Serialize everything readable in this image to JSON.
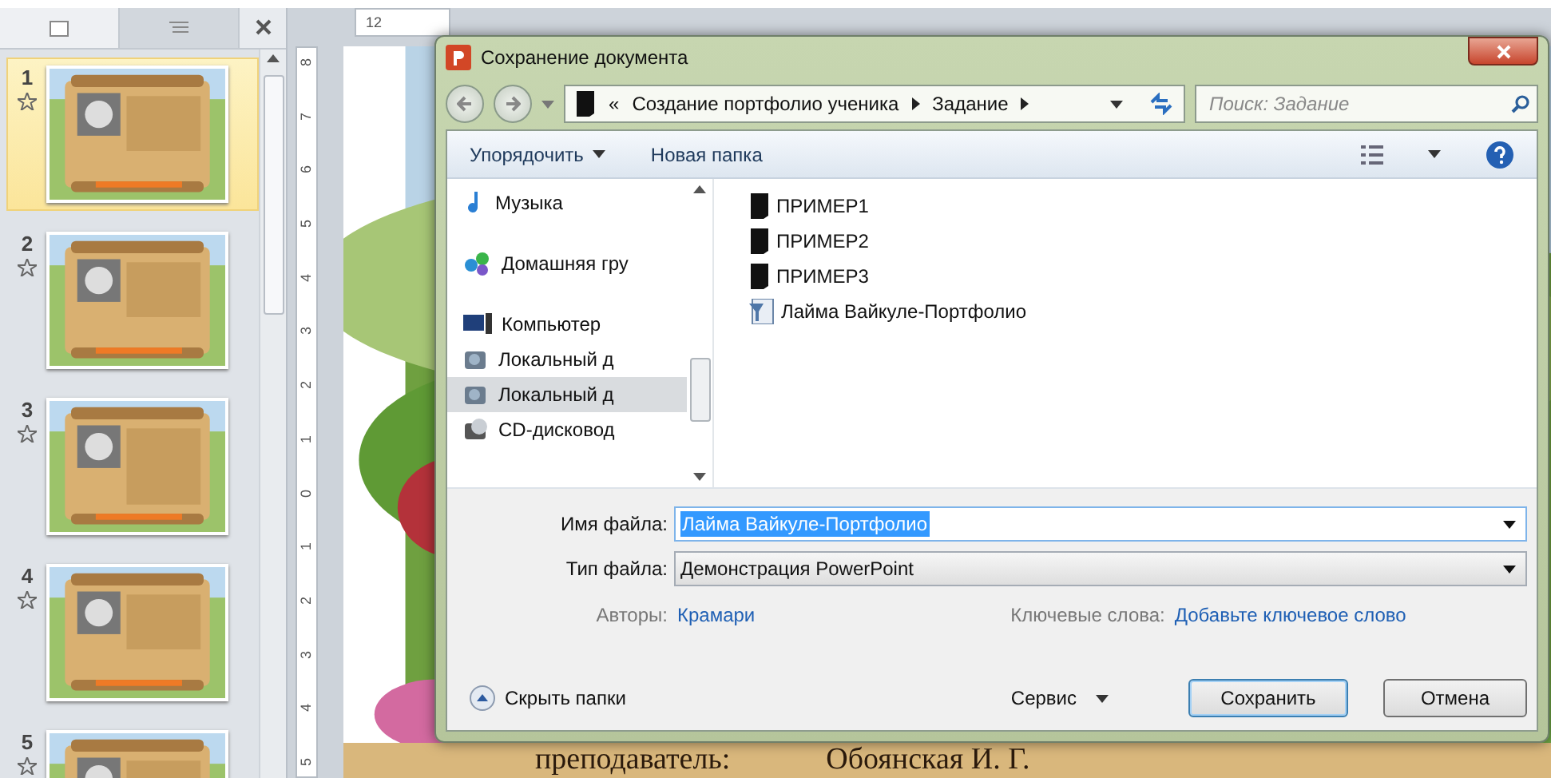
{
  "slides_panel": {
    "tabs": [
      {
        "kind": "slides",
        "selected": true
      },
      {
        "kind": "outline",
        "selected": false
      }
    ],
    "slides": [
      {
        "number": "1",
        "selected": true
      },
      {
        "number": "2",
        "selected": false
      },
      {
        "number": "3",
        "selected": false
      },
      {
        "number": "4",
        "selected": false
      },
      {
        "number": "5",
        "selected": false
      }
    ]
  },
  "horizontal_ruler": [
    "12"
  ],
  "vertical_ruler": [
    "8",
    "7",
    "6",
    "5",
    "4",
    "3",
    "2",
    "1",
    "0",
    "1",
    "2",
    "3",
    "4",
    "5"
  ],
  "slide_text": [
    "преподаватель:",
    "Обоянская И. Г."
  ],
  "dialog": {
    "title": "Сохранение документа",
    "breadcrumb": [
      "«",
      "Создание портфолио ученика",
      "Задание"
    ],
    "search": {
      "placeholder": "Поиск: Задание"
    },
    "toolbar": [
      "Упорядочить",
      "Новая папка"
    ],
    "nav": [
      {
        "kind": "music",
        "label": "Музыка",
        "selected": false
      },
      {
        "kind": "homegroup",
        "label": "Домашняя гру",
        "selected": false
      },
      {
        "kind": "computer",
        "label": "Компьютер",
        "selected": false
      },
      {
        "kind": "disk",
        "label": "Локальный д",
        "selected": false
      },
      {
        "kind": "disk",
        "label": "Локальный д",
        "selected": true
      },
      {
        "kind": "cd",
        "label": "CD-дисковод",
        "selected": false
      }
    ],
    "files": [
      {
        "kind": "folder",
        "name": "ПРИМЕР1"
      },
      {
        "kind": "folder",
        "name": "ПРИМЕР2"
      },
      {
        "kind": "folder",
        "name": "ПРИМЕР3"
      },
      {
        "kind": "presentation",
        "name": "Лайма Вайкуле-Портфолио"
      }
    ],
    "filename": {
      "label": "Имя файла:",
      "value": "Лайма Вайкуле-Портфолио"
    },
    "filetype": {
      "label": "Тип файла:",
      "value": "Демонстрация PowerPoint"
    },
    "authors": {
      "label": "Авторы:",
      "value": "Крамари"
    },
    "keywords": {
      "label": "Ключевые слова:",
      "value": "Добавьте ключевое слово"
    },
    "hide_folders": "Скрыть папки",
    "service": "Сервис",
    "buttons": [
      {
        "kind": "primary",
        "label": "Сохранить"
      },
      {
        "kind": "normal",
        "label": "Отмена"
      }
    ]
  }
}
